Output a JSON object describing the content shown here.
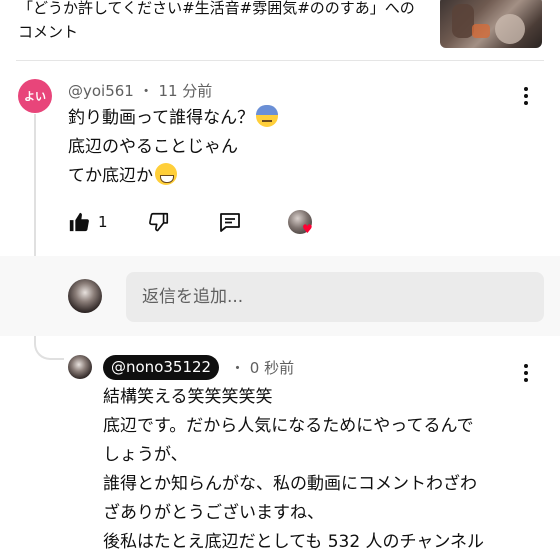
{
  "video": {
    "title_line1": "「どうか許してください#生活音#雰囲気#ののすあ」への",
    "title_line2": "コメント"
  },
  "comment": {
    "avatar_text": "よい",
    "author": "@yoi561",
    "separator": "・",
    "time": "11 分前",
    "lines": [
      "釣り動画って誰得なん？",
      "底辺のやることじゃん",
      "てか底辺か"
    ],
    "line_emojis": [
      "anxious-sweat-emoji",
      "",
      "grinning-sweat-emoji"
    ],
    "like_count": "1",
    "icons": {
      "like": "thumbs-up-filled-icon",
      "dislike": "thumbs-down-icon",
      "reply": "comment-icon",
      "creator_heart": "creator-heart-icon",
      "more": "more-vertical-icon"
    }
  },
  "reply_box": {
    "placeholder": "返信を追加..."
  },
  "reply": {
    "author": "@nono35122",
    "separator": "・",
    "time": "0 秒前",
    "lines": [
      "結構笑える笑笑笑笑笑",
      "底辺です。だから人気になるためにやってるんで",
      "しょうが、",
      "誰得とか知らんがな、私の動画にコメントわざわ",
      "ざありがとうございますね、",
      "後私はたとえ底辺だとしても 532 人のチャンネル"
    ]
  },
  "colors": {
    "avatar_pink": "#e8457a",
    "text_primary": "#0f0f0f",
    "text_secondary": "#606060",
    "heart_red": "#ff0033",
    "reply_band": "#f8f8f8"
  }
}
